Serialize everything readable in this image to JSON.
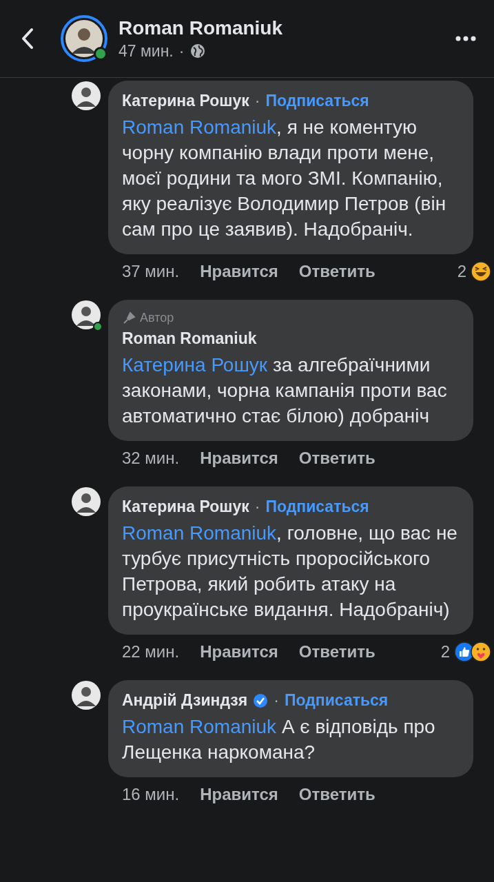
{
  "header": {
    "name": "Roman Romaniuk",
    "time": "47 мин.",
    "separator": "·",
    "online": true
  },
  "comments": [
    {
      "author": "Катерина Рошук",
      "verified": false,
      "separator": "·",
      "follow": "Подписаться",
      "mention": "Roman Romaniuk",
      "text": ", я не коментую чорну компанію влади проти мене, моєї родини та мого ЗМІ. Компанію, яку реалізує Володимир Петров (він сам про це заявив). Надобраніч.",
      "time": "37 мин.",
      "like": "Нравится",
      "reply": "Ответить",
      "online": false,
      "reactions": {
        "count": "2",
        "icons": [
          {
            "kind": "haha"
          }
        ]
      }
    },
    {
      "author": "Roman Romaniuk",
      "badge": "Автор",
      "verified": false,
      "mention": "Катерина Рошук",
      "text": " за алгебраїчними законами, чорна кампанія проти вас автоматично стає білою) добраніч",
      "time": "32 мин.",
      "like": "Нравится",
      "reply": "Ответить",
      "online": true
    },
    {
      "author": "Катерина Рошук",
      "verified": false,
      "separator": "·",
      "follow": "Подписаться",
      "mention": "Roman Romaniuk",
      "text": ", головне, що вас не турбує присутність проросійського Петрова, який робить атаку на проукраїнське видання. Надобраніч)",
      "time": "22 мин.",
      "like": "Нравится",
      "reply": "Ответить",
      "online": false,
      "reactions": {
        "count": "2",
        "icons": [
          {
            "kind": "like"
          },
          {
            "kind": "care"
          }
        ]
      }
    },
    {
      "author": "Андрій Дзиндзя",
      "verified": true,
      "separator": "·",
      "follow": "Подписаться",
      "mention": "Roman Romaniuk",
      "text": "  А є відповідь про Лещенка наркомана?",
      "time": "16 мин.",
      "like": "Нравится",
      "reply": "Ответить",
      "online": false
    }
  ]
}
